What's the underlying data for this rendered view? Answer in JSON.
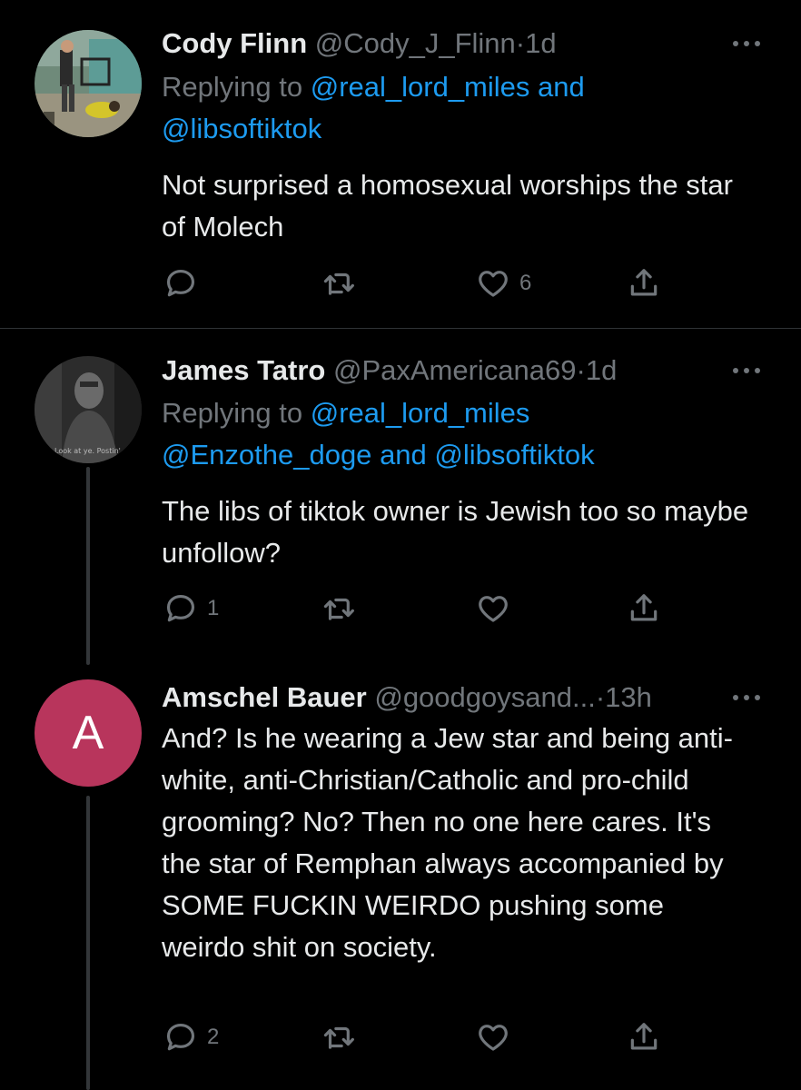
{
  "colors": {
    "background": "#000000",
    "text_primary": "#e7e9ea",
    "text_secondary": "#71767b",
    "link": "#1d9bf0",
    "avatar_letter_bg": "#b8355c"
  },
  "replying_label": "Replying to",
  "and_word": "and",
  "tweets": [
    {
      "name": "Cody Flinn",
      "handle": "@Cody_J_Flinn",
      "sep": "·",
      "time": "1d",
      "mentions": [
        "@real_lord_miles",
        "@libsoftiktok"
      ],
      "text": "Not surprised a homosexual worships the star of Molech",
      "reply_count": "",
      "retweet_count": "",
      "like_count": "6",
      "icons": [
        "reply-icon",
        "retweet-icon",
        "like-icon",
        "share-icon",
        "more-icon"
      ]
    },
    {
      "name": "James Tatro",
      "handle": "@PaxAmericana69",
      "sep": "·",
      "time": "1d",
      "mentions": [
        "@real_lord_miles",
        "@Enzothe_doge",
        "@libsoftiktok"
      ],
      "avatar_caption": "Look at ye. Postin' cringe",
      "text": "The libs of tiktok owner is Jewish too so maybe unfollow?",
      "reply_count": "1",
      "retweet_count": "",
      "like_count": "",
      "icons": [
        "reply-icon",
        "retweet-icon",
        "like-icon",
        "share-icon",
        "more-icon"
      ]
    },
    {
      "name": "Amschel Bauer",
      "handle": "@goodgoysand...",
      "sep": "·",
      "time": "13h",
      "avatar_letter": "A",
      "text": "And? Is he wearing a Jew star and being anti-white, anti-Christian/Catholic and pro-child grooming? No? Then no one here cares. It's the star of Remphan always accompanied by SOME FUCKIN WEIRDO pushing some weirdo shit on society.",
      "reply_count": "2",
      "retweet_count": "",
      "like_count": "",
      "icons": [
        "reply-icon",
        "retweet-icon",
        "like-icon",
        "share-icon",
        "more-icon"
      ]
    }
  ]
}
